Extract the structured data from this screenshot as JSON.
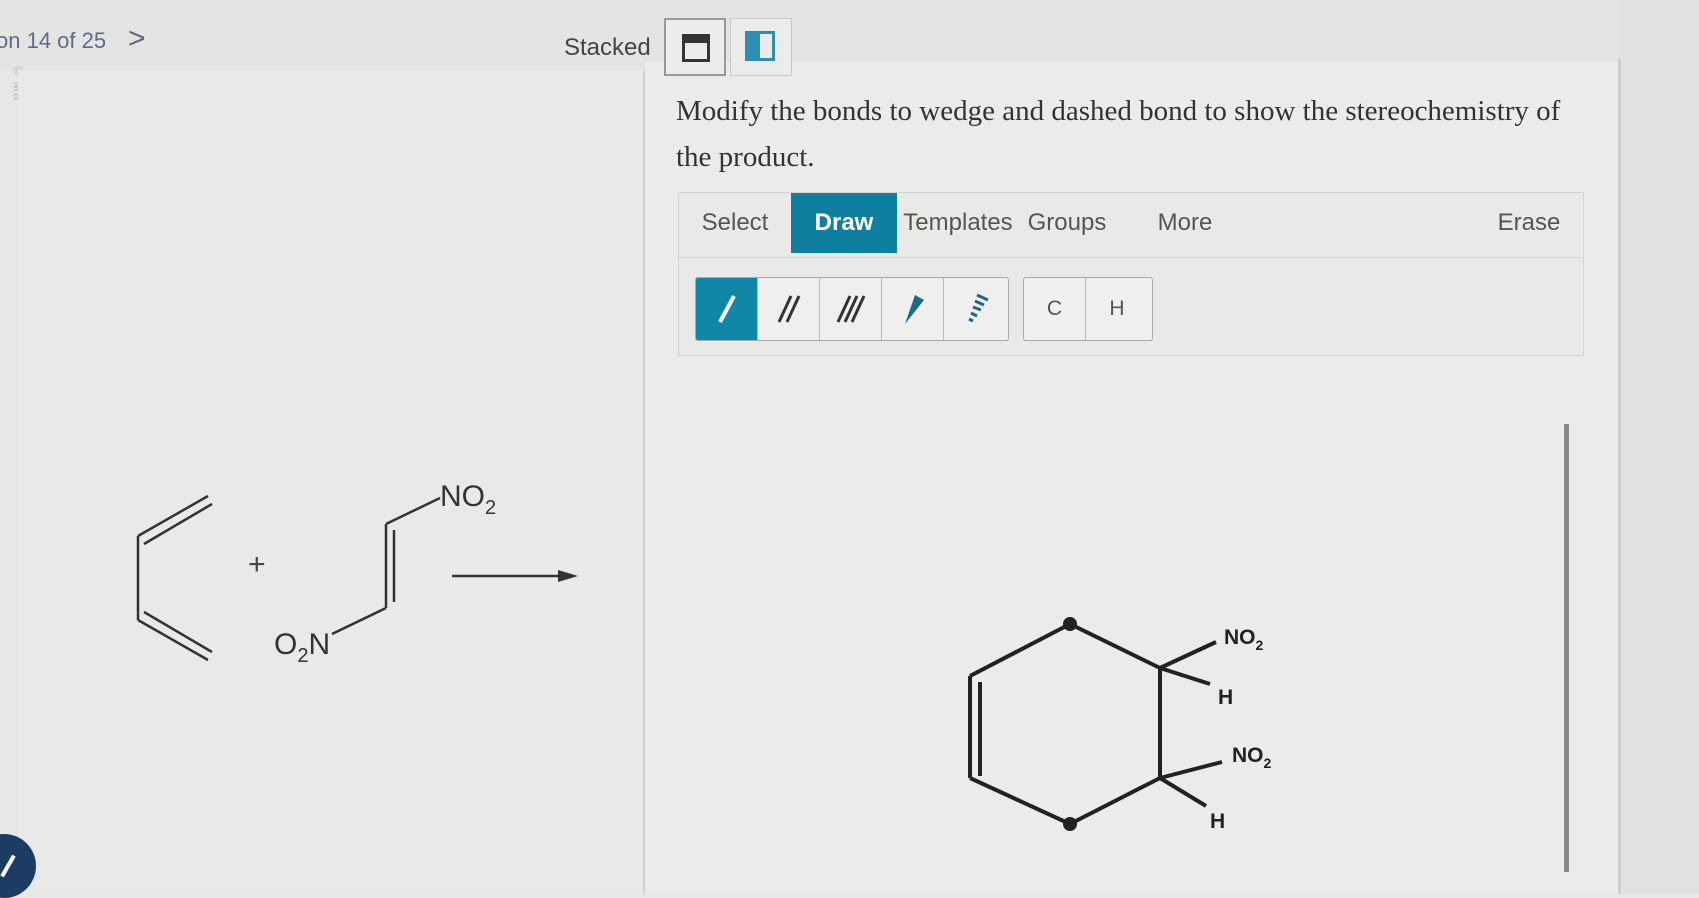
{
  "header": {
    "question_counter": "on 14 of 25",
    "next_symbol": ">",
    "side_logo": "© Ma",
    "view_label": "Stacked"
  },
  "question": {
    "instructions": "Modify the bonds to wedge and dashed bond to show the stereochemistry of the product."
  },
  "toolbar": {
    "tabs": [
      {
        "label": "Select",
        "active": false
      },
      {
        "label": "Draw",
        "active": true
      },
      {
        "label": "Templates",
        "active": false
      },
      {
        "label": "Groups",
        "active": false
      },
      {
        "label": "More",
        "active": false
      },
      {
        "label": "Erase",
        "active": false
      }
    ],
    "bond_tools": [
      "single-bond-icon",
      "double-bond-icon",
      "triple-bond-icon",
      "wedge-bond-icon",
      "dash-bond-icon"
    ],
    "atoms": [
      "C",
      "H"
    ]
  },
  "reaction": {
    "plus": "+",
    "no2_top": "NO",
    "no2_top_sub": "2",
    "o2n_left": "O",
    "o2n_sub": "2",
    "o2n_right": "N"
  },
  "product": {
    "no2_label": "NO",
    "no2_sub": "2",
    "h_label": "H"
  },
  "colors": {
    "accent": "#0e7f9e",
    "text": "#333333",
    "background": "#e9e9e7"
  }
}
